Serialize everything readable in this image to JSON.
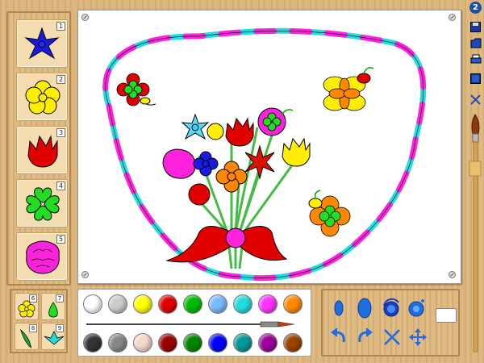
{
  "page_indicator": "2",
  "stamps": [
    {
      "number": "1",
      "icon": "cornflower-icon",
      "color": "#1a1ae0"
    },
    {
      "number": "2",
      "icon": "yellow-flower-icon",
      "color": "#ffee00"
    },
    {
      "number": "3",
      "icon": "tulip-icon",
      "color": "#e00000"
    },
    {
      "number": "4",
      "icon": "clover-icon",
      "color": "#22dd22"
    },
    {
      "number": "5",
      "icon": "carnation-icon",
      "color": "#ff22dd"
    }
  ],
  "small_stamps": [
    {
      "number": "6",
      "icon": "small-flower-icon"
    },
    {
      "number": "7",
      "icon": "drop-leaf-icon"
    },
    {
      "number": "8",
      "icon": "leaf-icon"
    },
    {
      "number": "9",
      "icon": "lily-icon"
    }
  ],
  "palette": {
    "row1": [
      "#ffffff",
      "#cccccc",
      "#ffff00",
      "#e00000",
      "#00bb00",
      "#77bbff",
      "#22dddd",
      "#ff33ff",
      "#ff8800"
    ],
    "row2": [
      "#333333",
      "#888888",
      "#f5d9c8",
      "#990000",
      "#008800",
      "#0000ff",
      "#009999",
      "#990099",
      "#994400"
    ]
  },
  "tools": [
    "small-brush-icon",
    "large-brush-icon",
    "fill-icon",
    "spray-icon",
    "undo-icon",
    "redo-icon",
    "clear-icon",
    "move-icon",
    "eraser-icon"
  ],
  "right_bar": [
    "save-icon",
    "open-icon",
    "print-icon",
    "new-page-icon",
    "close-icon"
  ]
}
